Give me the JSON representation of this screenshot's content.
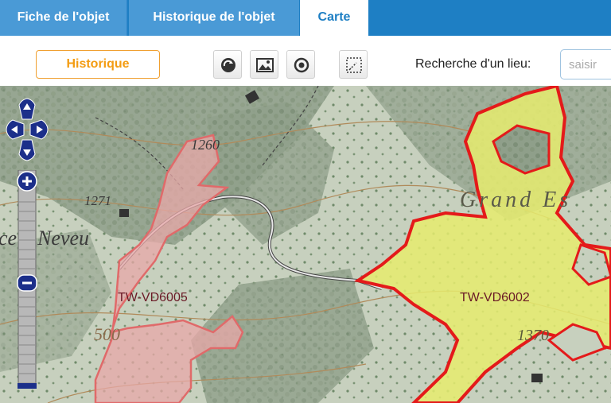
{
  "tabs": [
    {
      "label": "Fiche de l'objet",
      "active": false
    },
    {
      "label": "Historique de l'objet",
      "active": false
    },
    {
      "label": "Carte",
      "active": true
    }
  ],
  "toolbar": {
    "historique_label": "Historique",
    "tools": [
      "refresh-icon",
      "image-icon",
      "locate-icon",
      "select-area-icon"
    ],
    "search_label": "Recherche d'un lieu:",
    "search_placeholder": "saisir"
  },
  "map": {
    "map_texts": [
      "1260",
      "1271",
      "ce à Neveu",
      "500",
      "1370",
      "Grand Es"
    ],
    "objects": [
      {
        "id": "TW-VD6005",
        "fill": "#e8a8a8",
        "stroke": "#e06a6a"
      },
      {
        "id": "TW-VD6002",
        "fill": "#e6ec6e",
        "stroke": "#e41a1a"
      }
    ],
    "controls": [
      "pan-up",
      "pan-left",
      "pan-right",
      "pan-down",
      "zoom-in",
      "zoom-out"
    ]
  },
  "colors": {
    "accent": "#1e7fc4",
    "historique": "#f39c12"
  }
}
